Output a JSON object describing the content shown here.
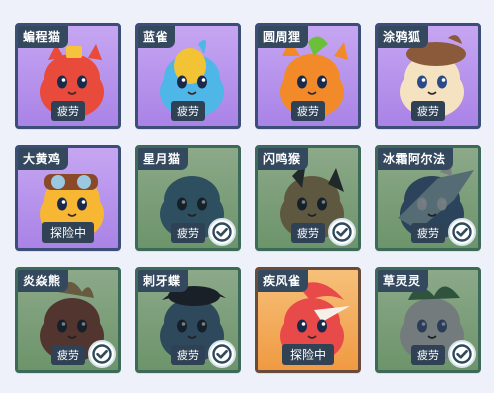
{
  "pets": [
    {
      "name": "蝙程猫",
      "status": "疲劳",
      "checked": false,
      "bg": "purple",
      "colors": {
        "body": "#e84a3c",
        "accent": "#f6c33f",
        "eye": "#1a2a4a"
      },
      "art_icon": "red-lucky-cat"
    },
    {
      "name": "蓝雀",
      "status": "疲劳",
      "checked": false,
      "bg": "purple",
      "colors": {
        "body": "#4fb6e8",
        "accent": "#f2c335",
        "eye": "#1a2a4a"
      },
      "art_icon": "blue-bird"
    },
    {
      "name": "圆周狸",
      "status": "疲劳",
      "checked": false,
      "bg": "purple",
      "colors": {
        "body": "#f28a2a",
        "accent": "#6bbf3a",
        "eye": "#1a2a4a"
      },
      "art_icon": "orange-raccoon"
    },
    {
      "name": "涂鸦狐",
      "status": "疲劳",
      "checked": false,
      "bg": "purple",
      "colors": {
        "body": "#f5e2c0",
        "accent": "#8a5a3a",
        "eye": "#2a4a8a"
      },
      "art_icon": "painter-fox"
    },
    {
      "name": "大黄鸡",
      "status": "探险中",
      "checked": false,
      "bg": "purple",
      "colors": {
        "body": "#f7b733",
        "accent": "#8a4a2a",
        "eye": "#1a2a4a"
      },
      "art_icon": "yellow-chicken"
    },
    {
      "name": "星月猫",
      "status": "疲劳",
      "checked": true,
      "bg": "green",
      "colors": {
        "body": "#2f9ad8",
        "accent": "#f5c542",
        "eye": "#1a2a4a"
      },
      "art_icon": "moon-cat"
    },
    {
      "name": "闪鸣猴",
      "status": "疲劳",
      "checked": true,
      "bg": "green",
      "colors": {
        "body": "#e0a33a",
        "accent": "#3a3a3a",
        "eye": "#1a2a4a"
      },
      "art_icon": "thunder-monkey"
    },
    {
      "name": "冰霜阿尔法",
      "status": "疲劳",
      "checked": true,
      "bg": "green",
      "colors": {
        "body": "#3a7ad8",
        "accent": "#9ad8f0",
        "eye": "#e8f4ff"
      },
      "art_icon": "frost-dragon"
    },
    {
      "name": "炎焱熊",
      "status": "疲劳",
      "checked": true,
      "bg": "green",
      "colors": {
        "body": "#e0492c",
        "accent": "#f6a63a",
        "eye": "#1a2a4a"
      },
      "art_icon": "fire-bear"
    },
    {
      "name": "刺牙蝶",
      "status": "疲劳",
      "checked": true,
      "bg": "green",
      "colors": {
        "body": "#3a8ad0",
        "accent": "#2a2a3a",
        "eye": "#1a2a4a"
      },
      "art_icon": "fang-butterfly"
    },
    {
      "name": "疾风雀",
      "status": "探险中",
      "checked": false,
      "bg": "orange",
      "colors": {
        "body": "#e84a4a",
        "accent": "#f6f0e8",
        "eye": "#1a2a4a"
      },
      "art_icon": "wind-bird"
    },
    {
      "name": "草灵灵",
      "status": "疲劳",
      "checked": true,
      "bg": "green",
      "colors": {
        "body": "#f2f6f0",
        "accent": "#3aa84a",
        "eye": "#3a6ad8"
      },
      "art_icon": "grass-sprite"
    }
  ]
}
